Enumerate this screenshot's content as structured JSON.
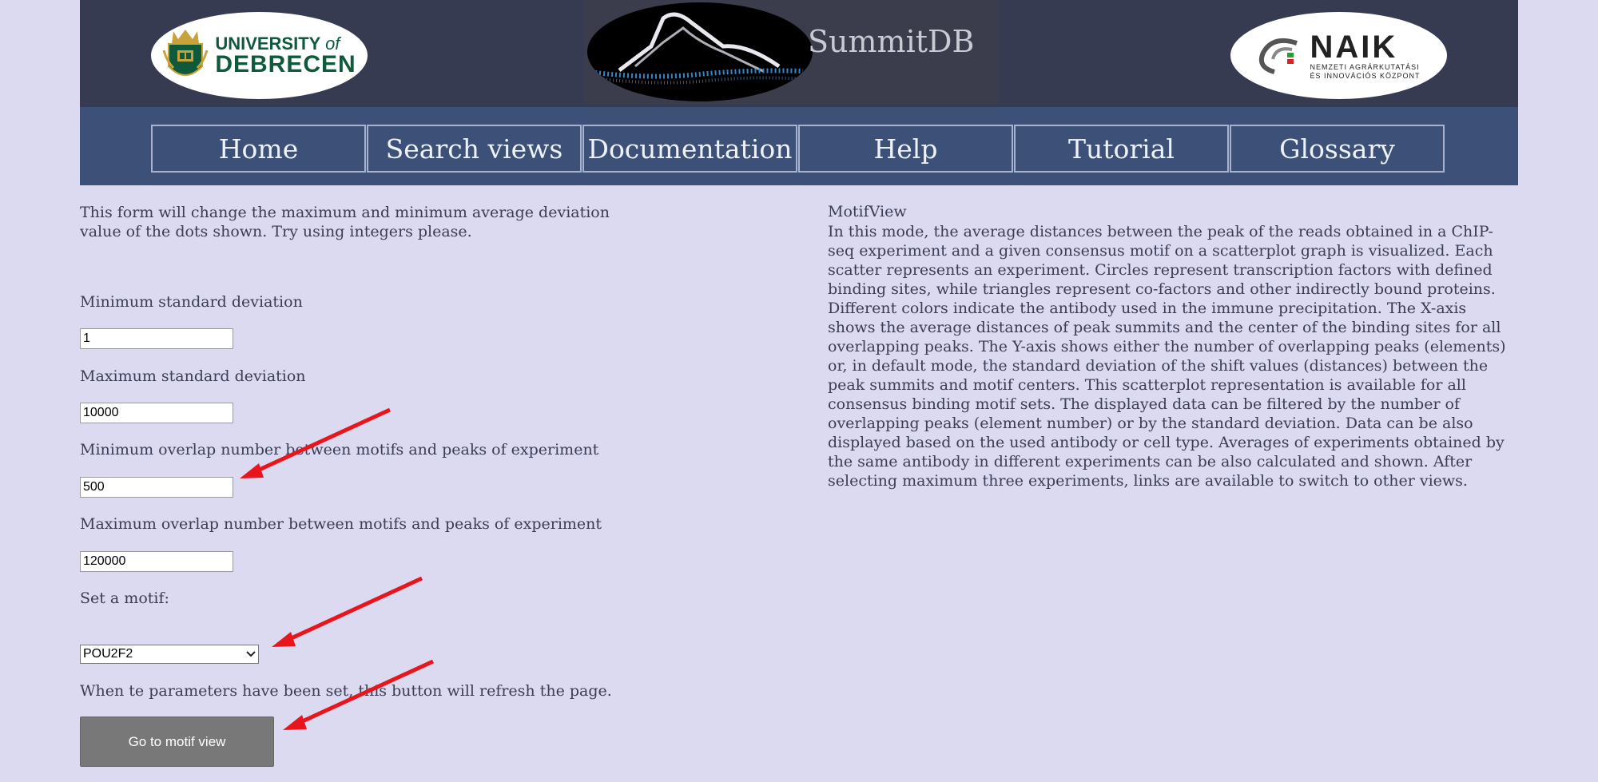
{
  "header": {
    "left_logo": {
      "line1": "UNIVERSITY",
      "line1_suffix": "of",
      "line2": "DEBRECEN"
    },
    "center_logo": {
      "title": "SummitDB"
    },
    "right_logo": {
      "name": "NAIK",
      "sub1": "NEMZETI AGRÁRKUTATÁSI",
      "sub2": "ÉS INNOVÁCIÓS KÖZPONT"
    }
  },
  "nav": {
    "items": [
      {
        "label": "Home"
      },
      {
        "label": "Search views"
      },
      {
        "label": "Documentation"
      },
      {
        "label": "Help"
      },
      {
        "label": "Tutorial"
      },
      {
        "label": "Glossary"
      }
    ]
  },
  "form": {
    "description": "This form will change the maximum and minimum average deviation value of the dots shown. Try using integers please.",
    "min_sd_label": "Minimum standard deviation",
    "min_sd_value": "1",
    "max_sd_label": "Maximum standard deviation",
    "max_sd_value": "10000",
    "min_overlap_label": "Minimum overlap number between motifs and peaks of experiment",
    "min_overlap_value": "500",
    "max_overlap_label": "Maximum overlap number between motifs and peaks of experiment",
    "max_overlap_value": "120000",
    "motif_label": "Set a motif:",
    "motif_selected": "POU2F2",
    "refresh_note": "When te parameters have been set, this button will refresh the page.",
    "submit_label": "Go to motif view"
  },
  "info": {
    "title": "MotifView",
    "body": "In this mode, the average distances between the peak of the reads obtained in a ChIP-seq experiment and a given consensus motif on a scatterplot graph is visualized. Each scatter represents an experiment. Circles represent transcription factors with defined binding sites, while triangles represent co-factors and other indirectly bound proteins. Different colors indicate the antibody used in the immune precipitation. The X-axis shows the average distances of peak summits and the center of the binding sites for all overlapping peaks. The Y-axis shows either the number of overlapping peaks (elements) or, in default mode, the standard deviation of the shift values (distances) between the peak summits and motif centers. This scatterplot representation is available for all consensus binding motif sets. The displayed data can be filtered by the number of overlapping peaks (element number) or by the standard deviation. Data can be also displayed based on the used antibody or cell type. Averages of experiments obtained by the same antibody in different experiments can be also calculated and shown. After selecting maximum three experiments, links are available to switch to other views."
  },
  "colors": {
    "page_bg": "#dcdaf1",
    "header_bg": "#363b51",
    "nav_bg": "#3c5078",
    "annotation_arrow": "#e8161c",
    "button_bg": "#787878"
  }
}
